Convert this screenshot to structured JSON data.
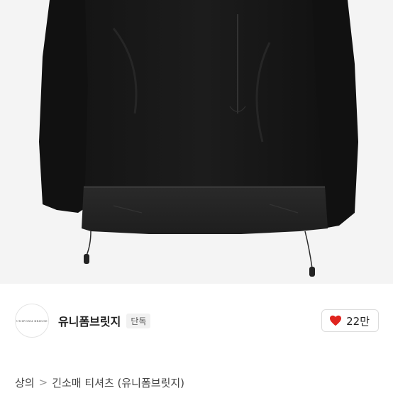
{
  "brand": {
    "logo_text": "Uniform Bridge",
    "name": "유니폼브릿지",
    "badge": "단독"
  },
  "like": {
    "icon": "heart-icon",
    "count": "22만",
    "color": "#e0241f"
  },
  "breadcrumb": {
    "category": "상의",
    "separator": ">",
    "subcategory": "긴소매 티셔츠 (유니폼브릿지)"
  }
}
